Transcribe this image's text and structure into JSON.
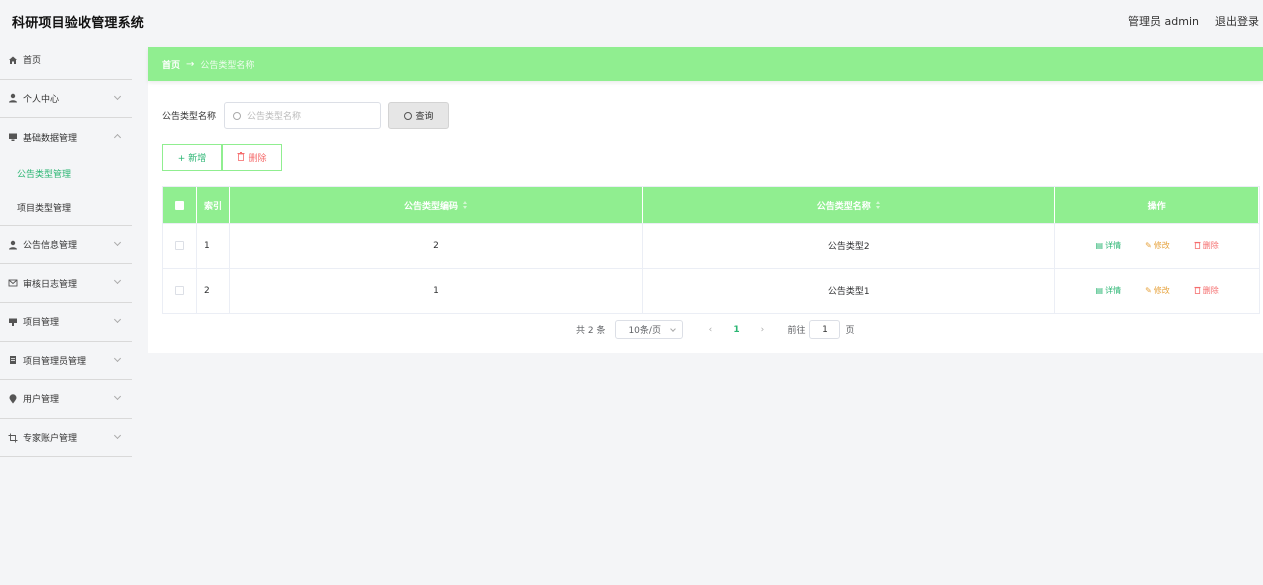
{
  "header": {
    "title": "科研项目验收管理系统",
    "user": "管理员 admin",
    "logout": "退出登录"
  },
  "sidebar": {
    "items": [
      {
        "label": "首页",
        "icon": "home-icon"
      },
      {
        "label": "个人中心",
        "icon": "user-icon"
      },
      {
        "label": "基础数据管理",
        "icon": "monitor-icon",
        "expanded": true,
        "children": [
          {
            "label": "公告类型管理",
            "active": true
          },
          {
            "label": "项目类型管理"
          }
        ]
      },
      {
        "label": "公告信息管理",
        "icon": "user-icon"
      },
      {
        "label": "审核日志管理",
        "icon": "mail-icon"
      },
      {
        "label": "项目管理",
        "icon": "board-icon"
      },
      {
        "label": "项目管理员管理",
        "icon": "document-icon"
      },
      {
        "label": "用户管理",
        "icon": "location-icon"
      },
      {
        "label": "专家账户管理",
        "icon": "crop-icon"
      }
    ]
  },
  "breadcrumb": {
    "home": "首页",
    "separator": "→",
    "current": "公告类型名称"
  },
  "search": {
    "label": "公告类型名称",
    "placeholder": "公告类型名称",
    "button": "查询"
  },
  "actions": {
    "add": "+ 新增",
    "delete": "删除"
  },
  "table": {
    "columns": [
      "索引",
      "公告类型编码",
      "公告类型名称",
      "操作"
    ],
    "rows": [
      {
        "index": "1",
        "code": "2",
        "name": "公告类型2"
      },
      {
        "index": "2",
        "code": "1",
        "name": "公告类型1"
      }
    ],
    "ops": {
      "detail": "详情",
      "edit": "修改",
      "delete": "删除"
    }
  },
  "pagination": {
    "total": "共 2 条",
    "page_size": "10条/页",
    "current_page": "1",
    "goto_label": "前往",
    "goto_value": "1",
    "page_suffix": "页"
  },
  "colors": {
    "accent_green": "#90ee90",
    "text_green": "#2bb673",
    "edit_orange": "#e6a23c",
    "delete_red": "#f56c6c"
  }
}
